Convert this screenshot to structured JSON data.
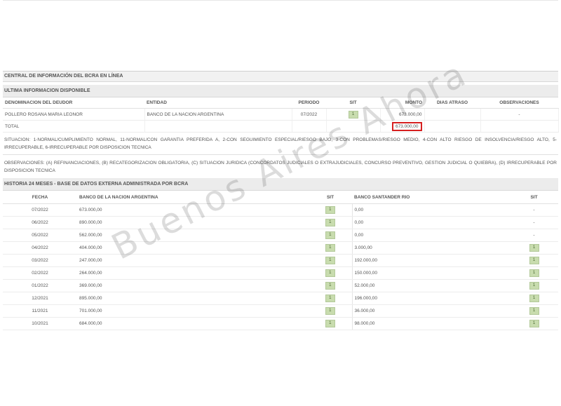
{
  "header": {
    "title": "CENTRAL DE INFORMACIÓN DEL BCRA EN LÍNEA",
    "section1": "ULTIMA INFORMACION DISPONIBLE"
  },
  "current": {
    "columns": [
      "DENOMINACION DEL DEUDOR",
      "ENTIDAD",
      "PERIODO",
      "SIT",
      "MONTO",
      "DIAS ATRASO",
      "OBSERVACIONES"
    ],
    "row": {
      "deudor": "POLLERO ROSANA MARIA LEONOR",
      "entidad": "BANCO DE LA NACION ARGENTINA",
      "periodo": "07/2022",
      "sit": "1",
      "monto": "673.000,00",
      "dias": "",
      "obs": "-"
    },
    "total": {
      "label": "TOTAL",
      "monto": "673.000,00"
    }
  },
  "legend": {
    "situacion": "SITUACION: 1-NORMAL/CUMPLIMIENTO NORMAL, 11-NORMAL/CON GARANTIA PREFERIDA A, 2-CON SEGUIMIENTO ESPECIAL/RIESGO BAJO, 3-CON PROBLEMAS/RIESGO MEDIO, 4-CON ALTO RIESGO DE INSOLVENCIA/RIESGO ALTO, 5-IRRECUPERABLE, 6-IRRECUPERABLE POR DISPOSICION TECNICA",
    "observaciones": "OBSERVACIONES: (A) REFINANCIACIONES, (B) RECATEGORIZACION OBLIGATORIA, (C) SITUACION JURIDICA (CONCORDATOS JUDICIALES O EXTRAJUDICIALES, CONCURSO PREVENTIVO, GESTION JUDICIAL O QUIEBRA), (D) IRRECUPERABLE POR DISPOSICION TECNICA"
  },
  "history": {
    "title": "HISTORIA 24 MESES - BASE DE DATOS EXTERNA ADMINISTRADA POR BCRA",
    "columns": [
      "FECHA",
      "BANCO DE LA NACION ARGENTINA",
      "SIT",
      "BANCO SANTANDER RIO",
      "SIT"
    ],
    "rows": [
      {
        "fecha": "07/2022",
        "bna": "673.000,00",
        "sit1": "1",
        "sant": "0,00",
        "sit2": "-"
      },
      {
        "fecha": "06/2022",
        "bna": "890.000,00",
        "sit1": "1",
        "sant": "0,00",
        "sit2": "-"
      },
      {
        "fecha": "05/2022",
        "bna": "562.000,00",
        "sit1": "1",
        "sant": "0,00",
        "sit2": "-"
      },
      {
        "fecha": "04/2022",
        "bna": "404.000,00",
        "sit1": "1",
        "sant": "3.000,00",
        "sit2": "1"
      },
      {
        "fecha": "03/2022",
        "bna": "247.000,00",
        "sit1": "1",
        "sant": "192.000,00",
        "sit2": "1"
      },
      {
        "fecha": "02/2022",
        "bna": "264.000,00",
        "sit1": "1",
        "sant": "150.000,00",
        "sit2": "1"
      },
      {
        "fecha": "01/2022",
        "bna": "369.000,00",
        "sit1": "1",
        "sant": "52.000,00",
        "sit2": "1"
      },
      {
        "fecha": "12/2021",
        "bna": "895.000,00",
        "sit1": "1",
        "sant": "196.000,00",
        "sit2": "1"
      },
      {
        "fecha": "11/2021",
        "bna": "701.000,00",
        "sit1": "1",
        "sant": "36.000,00",
        "sit2": "1"
      },
      {
        "fecha": "10/2021",
        "bna": "684.000,00",
        "sit1": "1",
        "sant": "98.000,00",
        "sit2": "1"
      }
    ]
  },
  "watermark": "Buenos Aires Ahora",
  "colors": {
    "sit_badge": "#c8dcae",
    "highlight": "#d62020",
    "header_bar": "#ececec"
  }
}
